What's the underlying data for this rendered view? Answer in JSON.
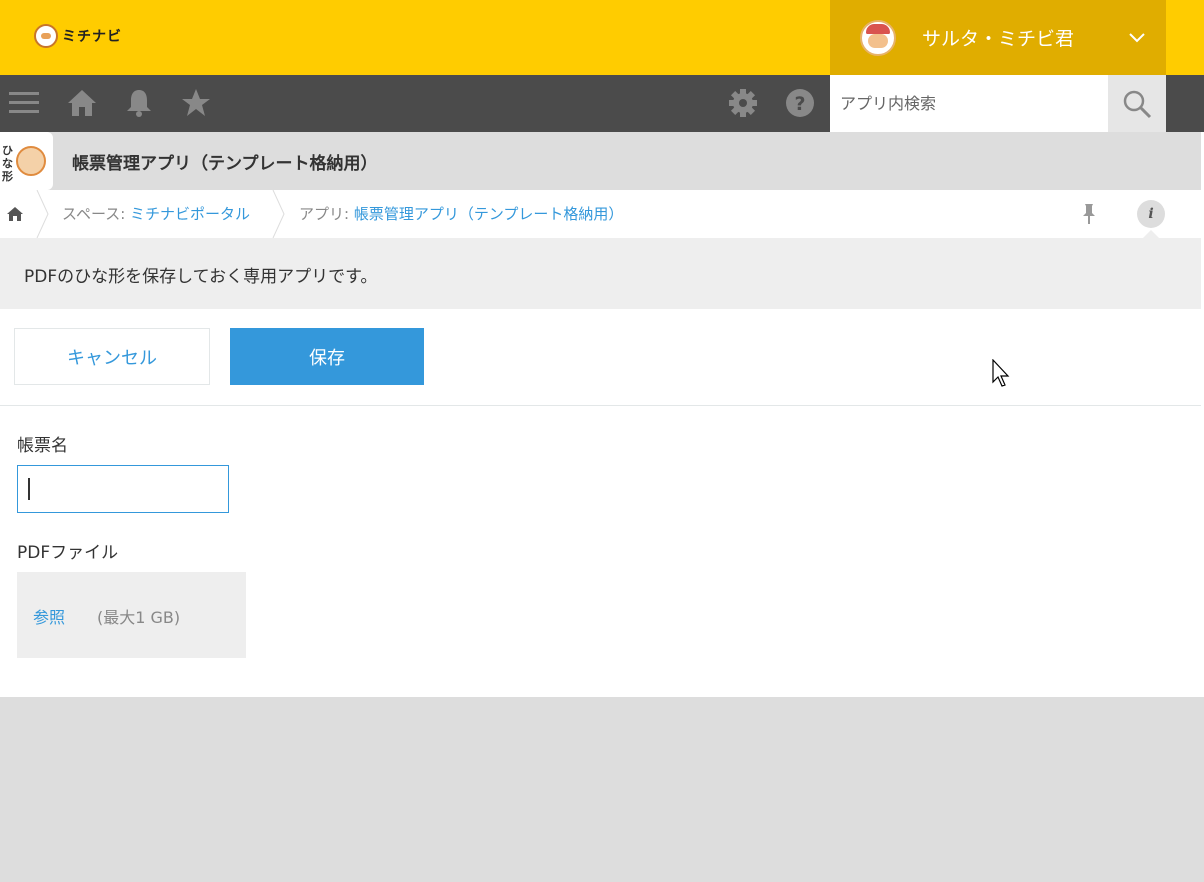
{
  "header": {
    "logo_text": "ミチナビ",
    "user_name": "サルタ・ミチビ君"
  },
  "navbar": {
    "icons": [
      "menu-icon",
      "home-icon",
      "bell-icon",
      "star-icon",
      "gear-icon",
      "help-icon",
      "search-icon"
    ],
    "search_placeholder": "アプリ内検索"
  },
  "app": {
    "icon_text": "ひな形",
    "title": "帳票管理アプリ（テンプレート格納用）"
  },
  "breadcrumb": {
    "space_prefix": "スペース: ",
    "space_name": "ミチナビポータル",
    "app_prefix": "アプリ: ",
    "app_name": "帳票管理アプリ（テンプレート格納用）",
    "info_label": "i"
  },
  "description": "PDFのひな形を保存しておく専用アプリです。",
  "form": {
    "cancel_label": "キャンセル",
    "save_label": "保存",
    "field_name_label": "帳票名",
    "field_name_value": "",
    "field_pdf_label": "PDFファイル",
    "browse_label": "参照",
    "max_size": "(最大1 GB)"
  },
  "colors": {
    "header_bg": "#ffcc00",
    "user_box_bg": "#e0ad00",
    "navbar_bg": "#4b4b4b",
    "accent": "#3498db"
  }
}
